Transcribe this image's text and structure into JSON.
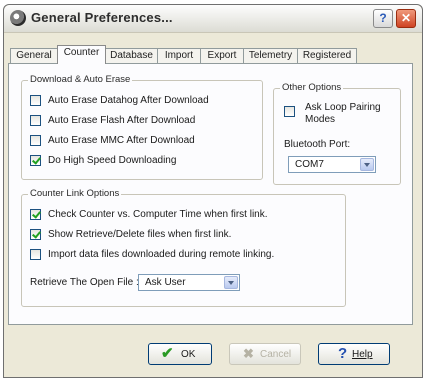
{
  "window": {
    "title": "General Preferences..."
  },
  "titlebar": {
    "help_glyph": "?",
    "close_glyph": "✕"
  },
  "tabs": [
    {
      "label": "General"
    },
    {
      "label": "Counter",
      "active": true
    },
    {
      "label": "Database"
    },
    {
      "label": "Import"
    },
    {
      "label": "Export"
    },
    {
      "label": "Telemetry"
    },
    {
      "label": "Registered"
    }
  ],
  "download_group": {
    "label": "Download & Auto Erase",
    "items": [
      {
        "label": "Auto Erase Datahog After Download",
        "checked": false
      },
      {
        "label": "Auto Erase Flash After Download",
        "checked": false
      },
      {
        "label": "Auto Erase MMC After Download",
        "checked": false
      },
      {
        "label": "Do High Speed Downloading",
        "checked": true
      }
    ]
  },
  "other_group": {
    "label": "Other Options",
    "ask_loop": {
      "label": "Ask Loop Pairing Modes",
      "checked": false
    },
    "bluetooth_label": "Bluetooth Port:",
    "bluetooth_value": "COM7"
  },
  "link_group": {
    "label": "Counter Link Options",
    "items": [
      {
        "label": "Check Counter vs. Computer Time when first link.",
        "checked": true
      },
      {
        "label": "Show Retrieve/Delete files when first link.",
        "checked": true
      },
      {
        "label": "Import data files downloaded during remote linking.",
        "checked": false
      }
    ],
    "retrieve_label": "Retrieve The Open File :",
    "retrieve_value": "Ask User"
  },
  "buttons": {
    "ok": "OK",
    "cancel": "Cancel",
    "help": "Help"
  },
  "icons": {
    "ok": "check-icon",
    "cancel": "cancel-icon",
    "help": "question-icon"
  },
  "colors": {
    "ok_check": "#2a9a25",
    "help_question": "#2450b0",
    "cancel_disabled": "#b5b2a4"
  }
}
